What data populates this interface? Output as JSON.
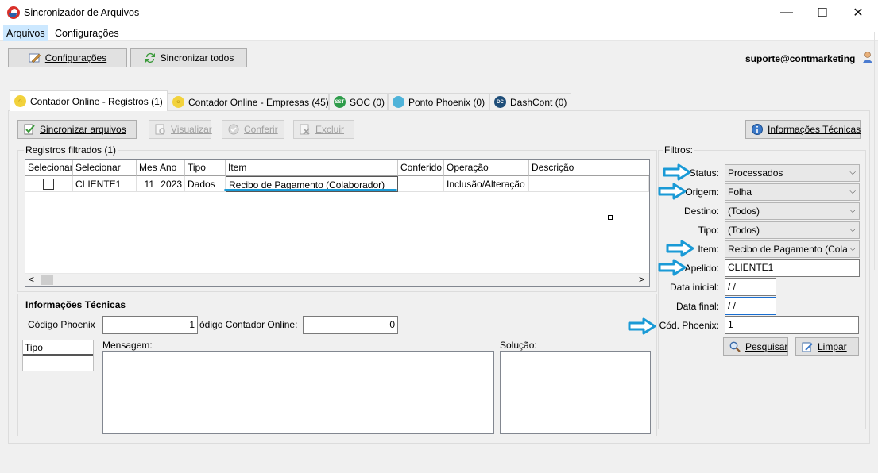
{
  "window": {
    "title": "Sincronizador de Arquivos",
    "minimize": "—",
    "maximize": "☐",
    "close": "✕"
  },
  "menu": {
    "items": [
      "Arquivos",
      "Configurações"
    ]
  },
  "toolbar": {
    "config_label": "Configurações",
    "sync_all_label": "Sincronizar todos",
    "user": "suporte@contmarketing"
  },
  "tabs": [
    {
      "label": "Contador Online - Registros (1)",
      "active": true,
      "icon_color": "#f2d23c"
    },
    {
      "label": "Contador Online - Empresas (45)",
      "active": false,
      "icon_color": "#f2d23c"
    },
    {
      "label": "SOC (0)",
      "active": false,
      "icon_color": "#2e9c4a"
    },
    {
      "label": "Ponto Phoenix (0)",
      "active": false,
      "icon_color": "#4fb3d9"
    },
    {
      "label": "DashCont (0)",
      "active": false,
      "icon_color": "#1f4e79"
    }
  ],
  "actions": {
    "sync_files": "Sincronizar arquivos",
    "view": "Visualizar",
    "check": "Conferir",
    "delete": "Excluir",
    "tech_info": "Informações Técnicas"
  },
  "records": {
    "group_label": "Registros filtrados (1)",
    "columns": [
      "Selecionar",
      "Selecionar",
      "Mes",
      "Ano",
      "Tipo",
      "Item",
      "Conferido",
      "Operação",
      "Descrição"
    ],
    "rows": [
      {
        "checked": false,
        "selecionar": "CLIENTE1",
        "mes": "11",
        "ano": "2023",
        "tipo": "Dados",
        "item": "Recibo de Pagamento (Colaborador)",
        "conferido": "",
        "operacao": "Inclusão/Alteração",
        "descricao": ""
      }
    ],
    "scroll_left": "<",
    "scroll_right": ">"
  },
  "tech": {
    "title": "Informações Técnicas",
    "codigo_phoenix_label": "Código Phoenix",
    "codigo_phoenix_value": "1",
    "codigo_contador_label": "ódigo Contador Online:",
    "codigo_contador_value": "0",
    "tipo_header": "Tipo",
    "mensagem_label": "Mensagem:",
    "solucao_label": "Solução:"
  },
  "filters": {
    "group_label": "Filtros:",
    "status_label": "Status:",
    "status_value": "Processados",
    "origem_label": "Origem:",
    "origem_value": "Folha",
    "destino_label": "Destino:",
    "destino_value": "(Todos)",
    "tipo_label": "Tipo:",
    "tipo_value": "(Todos)",
    "item_label": "Item:",
    "item_value": "Recibo de Pagamento (Cola",
    "apelido_label": "Apelido:",
    "apelido_value": "CLIENTE1",
    "data_inicial_label": "Data inicial:",
    "data_inicial_value": " / /",
    "data_final_label": "Data final:",
    "data_final_value": " / /",
    "cod_phoenix_label": "Cód. Phoenix:",
    "cod_phoenix_value": "1",
    "search_label": "Pesquisar",
    "clear_label": "Limpar"
  },
  "colors": {
    "annotation_arrow": "#1a9ad6",
    "selection": "#cce8ff"
  }
}
